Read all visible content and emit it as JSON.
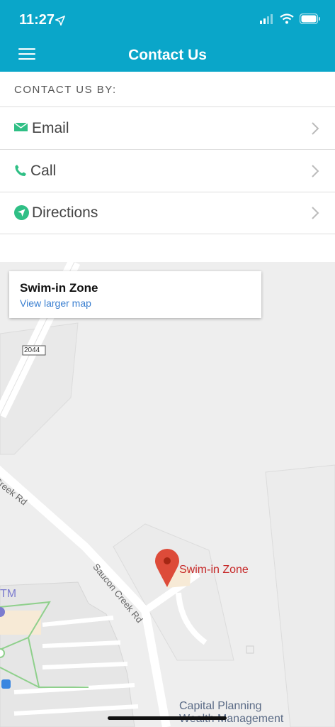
{
  "status": {
    "time": "11:27"
  },
  "header": {
    "title": "Contact Us"
  },
  "section": {
    "title": "CONTACT US BY:"
  },
  "options": [
    {
      "label": "Email",
      "icon": "email-icon"
    },
    {
      "label": "Call",
      "icon": "phone-icon"
    },
    {
      "label": "Directions",
      "icon": "navigation-icon"
    }
  ],
  "map": {
    "card_title": "Swim-in Zone",
    "card_link": "View larger map",
    "route_shield": "2044",
    "road_1": "Creek Rd",
    "road_2": "Saucon Creek Rd",
    "place_marker": "Swim-in Zone",
    "label_tm": "TM",
    "poi_line1": "Capital Planning",
    "poi_line2": "Wealth Management"
  },
  "colors": {
    "accent": "#0aa6c9",
    "icon_green": "#2fbf85",
    "link": "#3a7fd0",
    "marker": "#c62828"
  }
}
